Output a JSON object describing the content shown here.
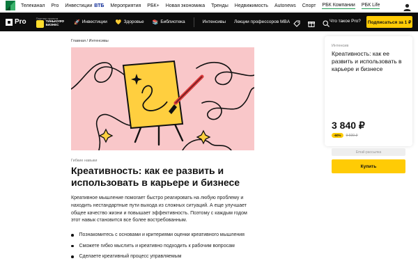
{
  "topbar": {
    "items": [
      "Телеканал",
      "Pro",
      "Инвестиции",
      "ВТБ",
      "Мероприятия",
      "РБК+",
      "Новая экономика",
      "Тренды",
      "Недвижимость",
      "Autonews",
      "Спорт",
      "РБК Компании",
      "РБК Life"
    ]
  },
  "header": {
    "logo": "Pro",
    "partner_caption": "Партнер проекта",
    "partner_name_1": "ТИНЬКОФФ",
    "partner_name_2": "БИЗНЕС",
    "nav": [
      {
        "label": "Инвестиции",
        "icon": "rocket-icon"
      },
      {
        "label": "Здоровье",
        "icon": "heart-icon"
      },
      {
        "label": "Библиотека",
        "icon": "book-icon"
      },
      {
        "label": "Интенсивы",
        "icon": ""
      },
      {
        "label": "Лекции профессоров MBA",
        "icon": ""
      }
    ],
    "what_is": "Что такое Pro?",
    "subscribe": "Подписаться за 1 ₽"
  },
  "breadcrumb": "Главная / Интенсивы",
  "article": {
    "category": "Гибкие навыки",
    "title": "Креативность: как ее развить и использовать в карьере и бизнесе",
    "lead": "Креативное мышление помогает быстро реагировать на любую проблему и находить нестандартные пути выхода из сложных ситуаций. А еще улучшает общее качество жизни и повышает эффективность. Поэтому с каждым годом этот навык становится все более востребованным.",
    "bullets": [
      "Познакомитесь с основами и критериями оценки креативного мышления",
      "Сможете гибко мыслить и креативно подходить к рабочим вопросам",
      "Сделаете креативный процесс управляемым"
    ]
  },
  "card": {
    "type": "Интенсив",
    "title": "Креативность: как ее развить и использовать в карьере и бизнесе",
    "price": "3 840 ₽",
    "discount": "-60%",
    "old_price": "9 600 ₽",
    "email_placeholder": "Email-рассылка",
    "buy": "Купить"
  },
  "colors": {
    "accent": "#ffcb05",
    "header_bg": "#0d0d0d",
    "hero_bg": "#f9c7c9"
  }
}
